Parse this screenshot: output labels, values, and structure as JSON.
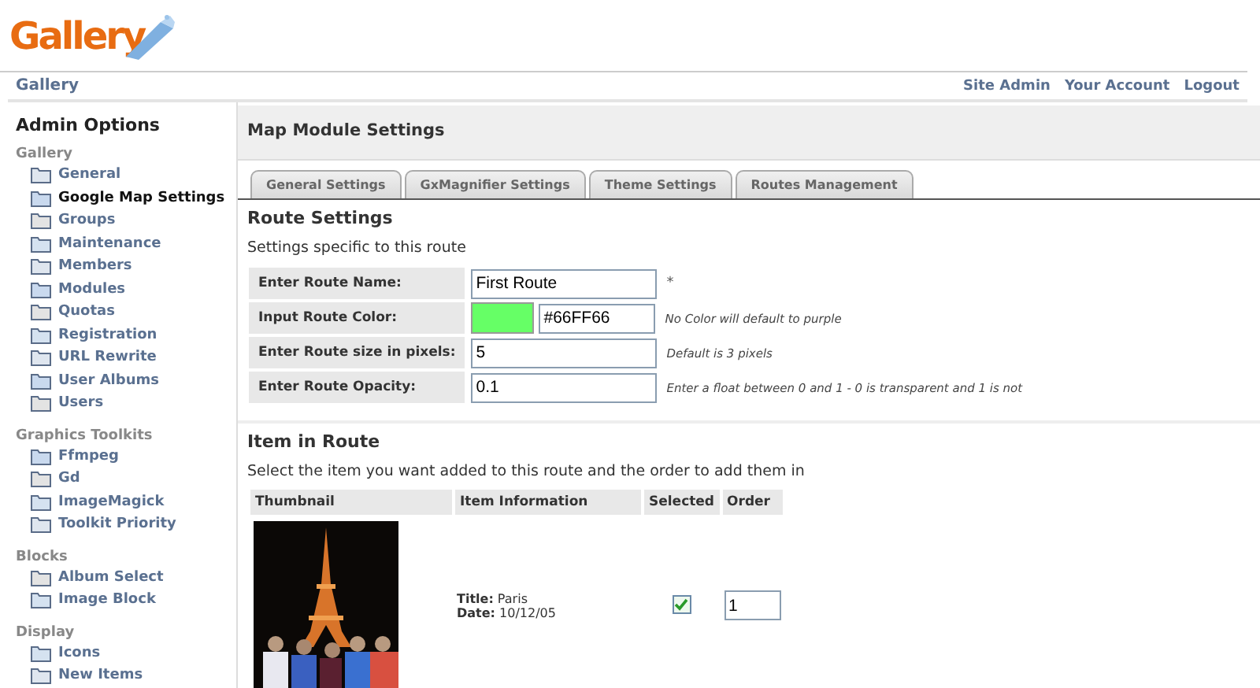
{
  "logo": {
    "text": "Gallery"
  },
  "breadcrumb": "Gallery",
  "top_links": [
    "Site Admin",
    "Your Account",
    "Logout"
  ],
  "sidebar": {
    "title": "Admin Options",
    "sections": [
      {
        "heading": "Gallery",
        "items": [
          {
            "label": "General",
            "selected": false
          },
          {
            "label": "Google Map Settings",
            "selected": true
          },
          {
            "label": "Groups",
            "selected": false
          },
          {
            "label": "Maintenance",
            "selected": false
          },
          {
            "label": "Members",
            "selected": false
          },
          {
            "label": "Modules",
            "selected": false
          },
          {
            "label": "Quotas",
            "selected": false
          },
          {
            "label": "Registration",
            "selected": false
          },
          {
            "label": "URL Rewrite",
            "selected": false
          },
          {
            "label": "User Albums",
            "selected": false
          },
          {
            "label": "Users",
            "selected": false
          }
        ]
      },
      {
        "heading": "Graphics Toolkits",
        "items": [
          {
            "label": "Ffmpeg",
            "selected": false
          },
          {
            "label": "Gd",
            "selected": false
          },
          {
            "label": "ImageMagick",
            "selected": false
          },
          {
            "label": "Toolkit Priority",
            "selected": false
          }
        ]
      },
      {
        "heading": "Blocks",
        "items": [
          {
            "label": "Album Select",
            "selected": false
          },
          {
            "label": "Image Block",
            "selected": false
          }
        ]
      },
      {
        "heading": "Display",
        "items": [
          {
            "label": "Icons",
            "selected": false
          },
          {
            "label": "New Items",
            "selected": false
          }
        ]
      }
    ]
  },
  "main": {
    "title": "Map Module Settings",
    "tabs": [
      "General Settings",
      "GxMagnifier Settings",
      "Theme Settings",
      "Routes Management"
    ],
    "route_settings": {
      "title": "Route Settings",
      "description": "Settings specific to this route",
      "fields": [
        {
          "label": "Enter Route Name:",
          "value": "First Route",
          "note": "*"
        },
        {
          "label": "Input Route Color:",
          "kind": "color",
          "color": "#66ff66",
          "value": "#66FF66",
          "note": "No Color will default to purple"
        },
        {
          "label": "Enter Route size in pixels:",
          "value": "5",
          "note": "Default is 3 pixels"
        },
        {
          "label": "Enter Route Opacity:",
          "value": "0.1",
          "note": "Enter a float between 0 and 1 - 0 is transparent and 1 is not"
        }
      ]
    },
    "items": {
      "title": "Item in Route",
      "description": "Select the item you want added to this route and the order to add them in",
      "columns": [
        "Thumbnail",
        "Item Information",
        "Selected",
        "Order"
      ],
      "rows": [
        {
          "title_label": "Title:",
          "title": "Paris",
          "date_label": "Date:",
          "date": "10/12/05",
          "checked": true,
          "order": "1"
        }
      ]
    }
  }
}
